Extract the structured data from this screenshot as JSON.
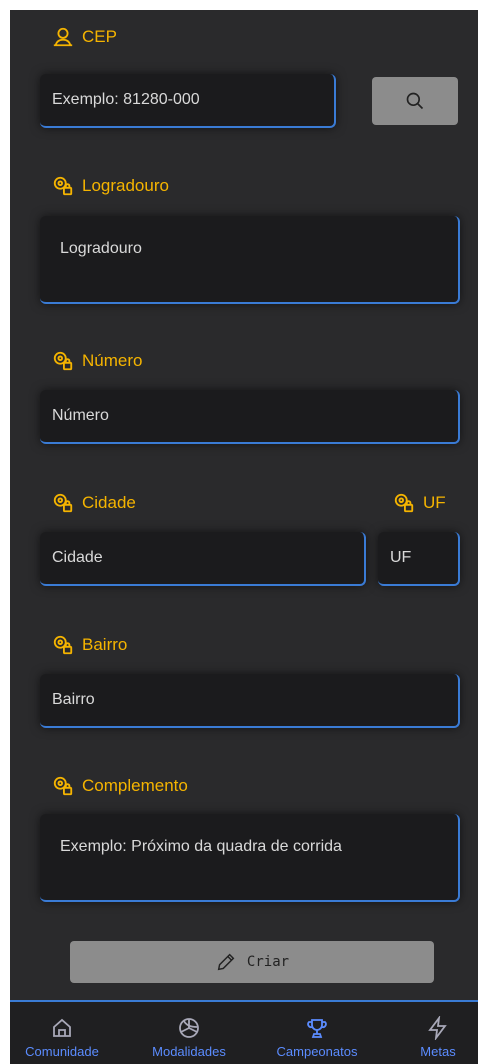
{
  "form": {
    "cep": {
      "label": "CEP",
      "placeholder": "Exemplo: 81280-000"
    },
    "logradouro": {
      "label": "Logradouro",
      "placeholder": "Logradouro"
    },
    "numero": {
      "label": "Número",
      "placeholder": "Número"
    },
    "cidade": {
      "label": "Cidade",
      "placeholder": "Cidade"
    },
    "uf": {
      "label": "UF",
      "placeholder": "UF"
    },
    "bairro": {
      "label": "Bairro",
      "placeholder": "Bairro"
    },
    "complemento": {
      "label": "Complemento",
      "placeholder": "Exemplo: Próximo da quadra de corrida"
    },
    "create_label": "Criar"
  },
  "nav": {
    "items": [
      {
        "label": "Comunidade",
        "icon": "home-icon"
      },
      {
        "label": "Modalidades",
        "icon": "volleyball-icon"
      },
      {
        "label": "Campeonatos",
        "icon": "trophy-icon",
        "active": true
      },
      {
        "label": "Metas",
        "icon": "lightning-icon"
      }
    ]
  },
  "colors": {
    "label_accent": "#f5b400",
    "field_border": "#3a7bd5",
    "nav_active": "#5b8cff",
    "background": "#2a2a2c"
  }
}
